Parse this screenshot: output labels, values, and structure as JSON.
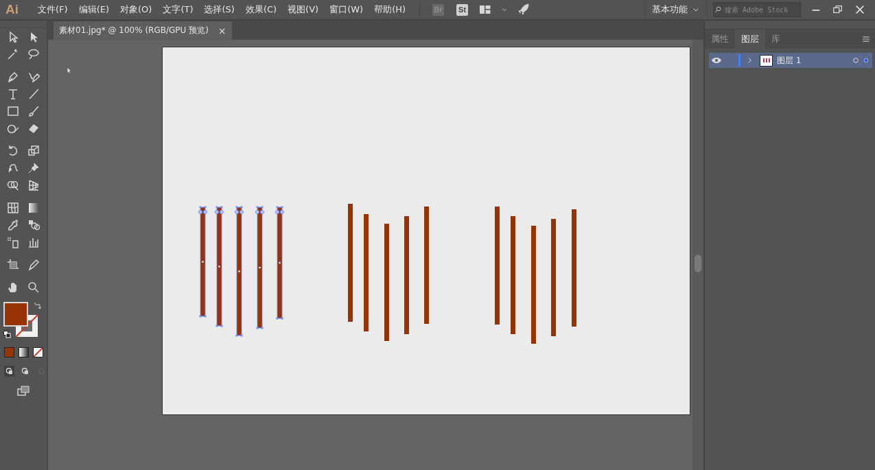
{
  "app": {
    "logo": "Ai",
    "bridge": "Br",
    "stock": "St"
  },
  "menu": [
    "文件(F)",
    "编辑(E)",
    "对象(O)",
    "文字(T)",
    "选择(S)",
    "效果(C)",
    "视图(V)",
    "窗口(W)",
    "帮助(H)"
  ],
  "workspace": "基本功能",
  "search": {
    "placeholder": "搜索 Adobe Stock"
  },
  "document_tab": {
    "title": "素材01.jpg* @ 100% (RGB/GPU 预览)",
    "close": "×"
  },
  "bar_groups": [
    {
      "selected": true
    },
    {
      "selected": false
    },
    {
      "selected": false
    }
  ],
  "panel_tabs": [
    {
      "label": "属性",
      "selected": false
    },
    {
      "label": "图层",
      "selected": true
    },
    {
      "label": "库",
      "selected": false
    }
  ],
  "layers": [
    {
      "name": "图层 1",
      "selected": true,
      "visible": true
    }
  ]
}
